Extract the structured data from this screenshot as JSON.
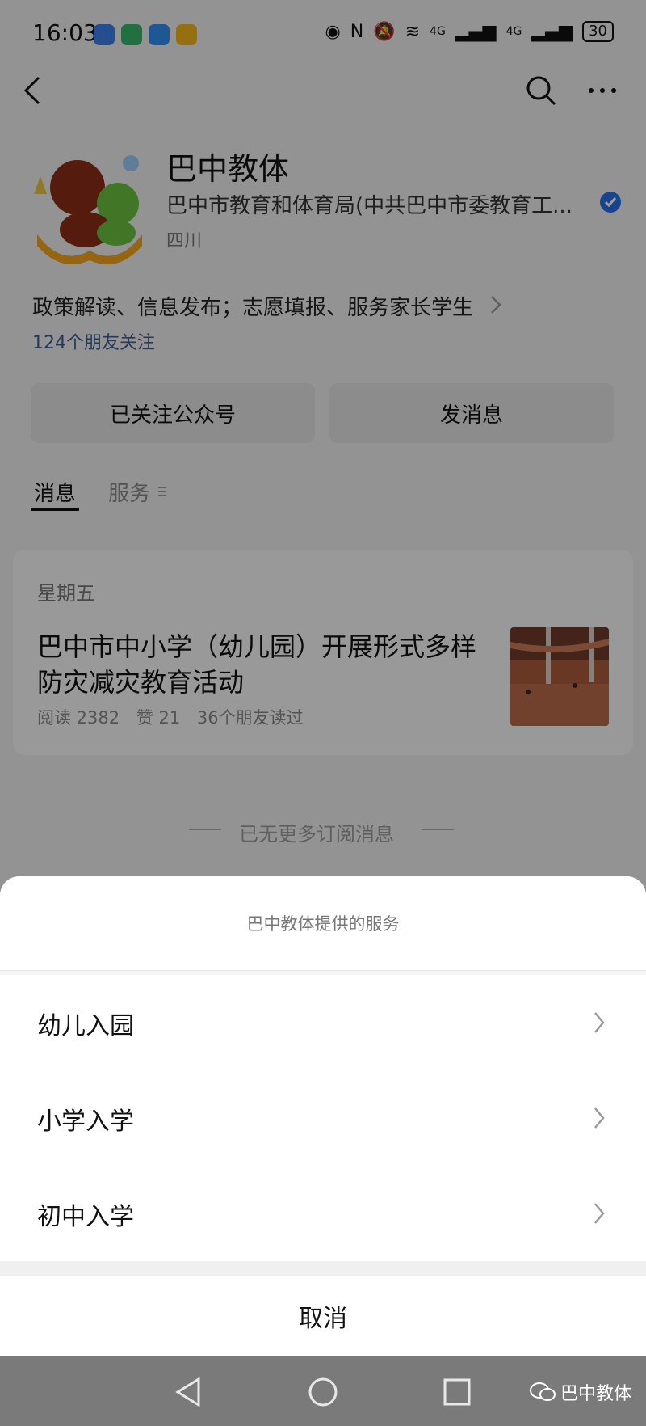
{
  "status_bar": {
    "time": "16:03",
    "network": [
      "4G",
      "4G"
    ],
    "battery": "30"
  },
  "header": {
    "back_icon": "back-arrow-icon",
    "search_icon": "search-icon",
    "more_icon": "more-icon"
  },
  "account": {
    "title": "巴中教体",
    "entity": "巴中市教育和体育局(中共巴中市委教育工...",
    "region": "四川",
    "description": "政策解读、信息发布；志愿填报、服务家长学生",
    "friends_follow": "124个朋友关注",
    "verified_color": "#2b6de4"
  },
  "buttons": {
    "followed": "已关注公众号",
    "send_message": "发消息"
  },
  "tabs": [
    {
      "label": "消息",
      "active": true
    },
    {
      "label": "服务",
      "active": false
    }
  ],
  "article_card": {
    "day": "星期五",
    "title": "巴中市中小学（幼儿园）开展形式多样防灾减灾教育活动",
    "stats": [
      "阅读 2382",
      "赞 21",
      "36个朋友读过"
    ]
  },
  "end_notice": "已无更多订阅消息",
  "service_sheet": {
    "title": "巴中教体提供的服务",
    "items": [
      {
        "label": "幼儿入园"
      },
      {
        "label": "小学入学"
      },
      {
        "label": "初中入学"
      }
    ],
    "cancel": "取消"
  },
  "watermark": {
    "text": "巴中教体",
    "icon": "wechat-icon"
  }
}
